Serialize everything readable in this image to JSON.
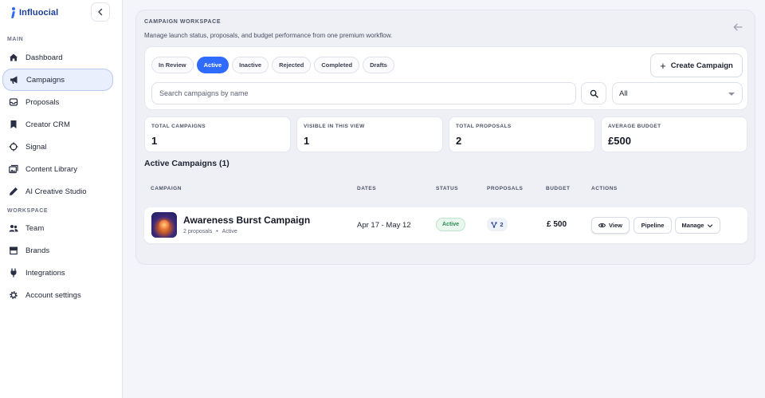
{
  "brand": {
    "name": "Influocial"
  },
  "sidebar": {
    "sections": [
      {
        "label": "MAIN"
      },
      {
        "label": "WORKSPACE"
      }
    ],
    "main_items": [
      {
        "label": "Dashboard",
        "icon": "home-icon"
      },
      {
        "label": "Campaigns",
        "icon": "megaphone-icon",
        "active": true
      },
      {
        "label": "Proposals",
        "icon": "inbox-icon"
      },
      {
        "label": "Creator CRM",
        "icon": "bookmark-icon"
      },
      {
        "label": "Signal",
        "icon": "crosshair-icon"
      },
      {
        "label": "Content Library",
        "icon": "gallery-icon"
      },
      {
        "label": "AI Creative Studio",
        "icon": "pen-icon"
      }
    ],
    "workspace_items": [
      {
        "label": "Team",
        "icon": "users-icon"
      },
      {
        "label": "Brands",
        "icon": "store-icon"
      },
      {
        "label": "Integrations",
        "icon": "plug-icon"
      },
      {
        "label": "Account settings",
        "icon": "gear-icon"
      }
    ]
  },
  "workspace": {
    "title": "CAMPAIGN WORKSPACE",
    "subtitle": "Manage launch status, proposals, and budget performance from one premium workflow."
  },
  "filters": {
    "tabs": [
      {
        "label": "In Review"
      },
      {
        "label": "Active",
        "active": true
      },
      {
        "label": "Inactive"
      },
      {
        "label": "Rejected"
      },
      {
        "label": "Completed"
      },
      {
        "label": "Drafts"
      }
    ],
    "create_label": "Create Campaign",
    "search_placeholder": "Search campaigns by name",
    "search_value": "",
    "select_value": "All"
  },
  "stats": [
    {
      "label": "TOTAL CAMPAIGNS",
      "value": "1"
    },
    {
      "label": "VISIBLE IN THIS VIEW",
      "value": "1"
    },
    {
      "label": "TOTAL PROPOSALS",
      "value": "2"
    },
    {
      "label": "AVERAGE BUDGET",
      "value": "£500"
    }
  ],
  "active_heading": "Active Campaigns (1)",
  "table": {
    "headers": {
      "campaign": "CAMPAIGN",
      "dates": "DATES",
      "status": "STATUS",
      "proposals": "PROPOSALS",
      "budget": "BUDGET",
      "actions": "ACTIONS"
    },
    "rows": [
      {
        "name": "Awareness Burst Campaign",
        "meta_proposals": "2 proposals",
        "meta_sep": "•",
        "meta_status": "Active",
        "dates": "Apr 17 - May 12",
        "status": "Active",
        "proposals": "2",
        "budget": "£ 500",
        "actions": {
          "view": "View",
          "pipeline": "Pipeline",
          "manage": "Manage"
        }
      }
    ]
  },
  "colors": {
    "accent": "#2f6bff",
    "active_badge": "#2f8a52",
    "brand": "#1d3f9b"
  }
}
